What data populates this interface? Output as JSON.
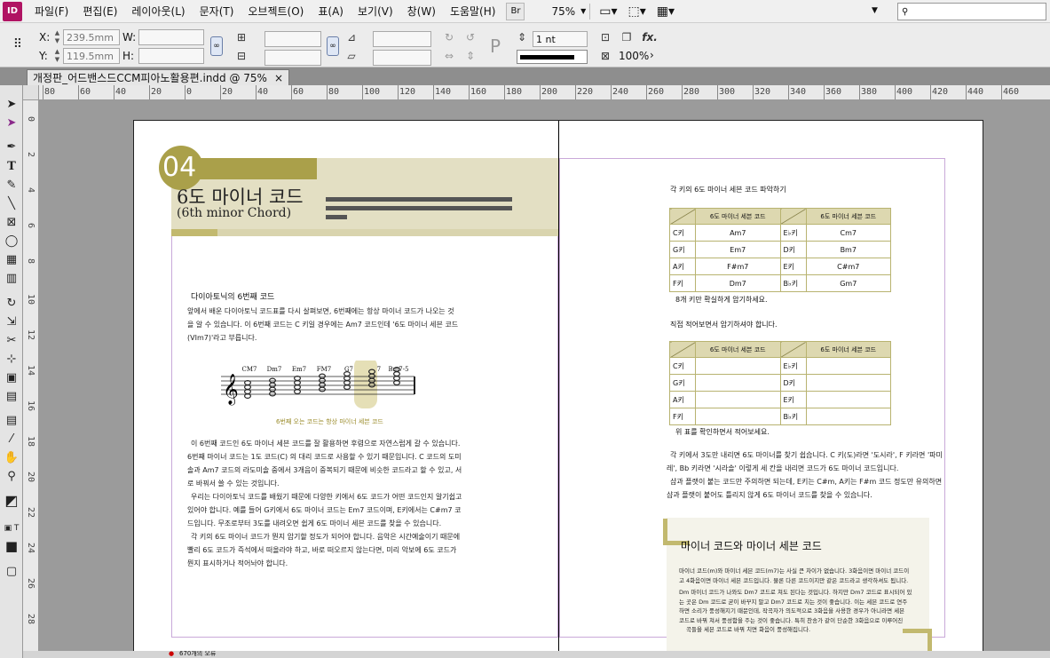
{
  "app": {
    "logo": "ID"
  },
  "menu": [
    "파일(F)",
    "편집(E)",
    "레이아웃(L)",
    "문자(T)",
    "오브젝트(O)",
    "표(A)",
    "보기(V)",
    "창(W)",
    "도움말(H)"
  ],
  "toolbar": {
    "bridge": "Br",
    "zoom": "75%",
    "zoom_caret": "▼"
  },
  "control": {
    "x_label": "X:",
    "x_value": "239.5mm",
    "y_label": "Y:",
    "y_value": "119.5mm",
    "w_label": "W:",
    "h_label": "H:",
    "stroke_weight": "1 nt",
    "opacity": "100%",
    "fx": "fx."
  },
  "document_tab": {
    "title": "개정판_어드밴스드CCM피아노활용편.indd @ 75%",
    "close": "×"
  },
  "ruler": {
    "h_ticks": [
      "80",
      "60",
      "40",
      "20",
      "0",
      "20",
      "40",
      "60",
      "80",
      "100",
      "120",
      "140",
      "160",
      "180",
      "200",
      "220",
      "240",
      "260",
      "280",
      "300",
      "320",
      "340",
      "360",
      "380",
      "400",
      "420",
      "440",
      "460"
    ],
    "v_ticks": [
      "0",
      "2",
      "4",
      "6",
      "8",
      "10",
      "12",
      "14",
      "16",
      "18",
      "20",
      "22",
      "24",
      "26",
      "28"
    ]
  },
  "left_page": {
    "chapter_number": "04",
    "title_ko": "6도 마이너 코드",
    "title_en": "(6th minor  Chord)",
    "section_head": "다이아토닉의 6번째 코드",
    "paragraph1": [
      "앞에서 배운 다이아토닉 코드표를 다시 살펴보면, 6번째에는 항상 마이너 코드가 나오는 것",
      "을 알 수 있습니다. 이 6번째 코드는 C 키일 경우에는 Am7 코드인데 '6도 마이너 세븐 코드",
      "(VIm7)'라고 부릅니다."
    ],
    "chord_names": [
      "CM7",
      "Dm7",
      "Em7",
      "FM7",
      "G7",
      "Am7",
      "Bm7-5"
    ],
    "staff_caption": "6번째 오는 코드는 항상 마이너 세븐 코드",
    "paragraph2": [
      "이 6번째 코드인 6도 마이너 세븐 코드를 잘 활용하면 후렴으로 자연스럽게 갈 수 있습니다.",
      "6번째 마이너 코드는 1도 코드(C) 의 대리 코드로 사용할 수 있기 때문입니다. C 코드의 도미",
      "솔과 Am7 코드의 라도미솔 중에서 3개음이 중복되기 때문에 비슷한 코드라고 할 수 있고, 서",
      "로 바꿔서 쓸 수 있는 것입니다.",
      "우리는 다이아토닉 코드를 배웠기 때문에 다양한 키에서 6도 코드가 어떤 코드인지 알기쉽고",
      "있어야 합니다. 예를 들어 G키에서 6도 마이너 코드는 Em7 코드이며, E키에서는 C#m7 코",
      "드입니다. 무조로부터 3도를 내려오면 쉽게 6도 마이너 세븐 코드를 찾을 수 있습니다.",
      "각 키의 6도 마이너 코드가 뭔지 암기할 정도가 되어야 합니다. 음악은 시간예술이기 때문에",
      "빨리 6도 코드가 즉석에서 떠올라야 하고, 바로 떠오르지 않는다면, 미리 악보에 6도 코드가",
      "뭔지 표시하거나 적어놔야 합니다."
    ]
  },
  "right_page": {
    "table1_title": "각 키의 6도 마이너 세븐 코드 파악하기",
    "table_header": "6도 마이너 세븐 코드",
    "table1_rows": [
      [
        "C키",
        "Am7",
        "E♭키",
        "Cm7"
      ],
      [
        "G키",
        "Em7",
        "D키",
        "Bm7"
      ],
      [
        "A키",
        "F#m7",
        "E키",
        "C#m7"
      ],
      [
        "F키",
        "Dm7",
        "B♭키",
        "Gm7"
      ]
    ],
    "table1_note": "8개 키만 확실하게 암기하세요.",
    "table2_title": "직접 적어보면서 암기하셔야 합니다.",
    "table2_rows": [
      [
        "C키",
        "",
        "E♭키",
        ""
      ],
      [
        "G키",
        "",
        "D키",
        ""
      ],
      [
        "A키",
        "",
        "E키",
        ""
      ],
      [
        "F키",
        "",
        "B♭키",
        ""
      ]
    ],
    "table2_note": "위 표를 확인하면서 적어보세요.",
    "paragraph": [
      "각 키에서 3도만 내리면 6도 마이너를 찾기 쉽습니다. C 키(도)라면 '도시라', F 키라면 '파미",
      "레', Bb 키라면 '시라솔' 이렇게 세 칸을 내리면 코드가 6도 마이너 코드입니다.",
      "샵과 플랫이 붙는 코드만 주의하면 되는데, E키는 C#m, A키는 F#m 코드 정도만 유의하면",
      "샵과 플랫이 붙어도 틀리지 않게 6도 마이너 코드를 찾을 수 있습니다."
    ],
    "tip_title": "마이너 코드와 마이너 세븐 코드",
    "tip_body": [
      "마이너 코드(m)와 마이너 세븐 코드(m7)는 사실 큰 차이가 없습니다. 3화음이면 마이너 코드이",
      "고 4화음이면 마이너 세븐 코드입니다. 물론 다른 코드이지만 같은 코드라고 생각하셔도 됩니다.",
      "Dm 마이너 코드가 나와도 Dm7 코드로 쳐도 된다는 것입니다. 하지만 Dm7 코드로 표시되어 있",
      "는 곳은 Dm 코드로 굳이 바꾸지 말고 Dm7 코드로 치는 것이 좋습니다. 이는 세븐 코드로 연주",
      "하면 소리가 풍성해지기 때문인데, 작곡자가 의도적으로 3화음을 사용한 경우가 아니라면 세븐",
      "코드로 바꿔 쳐서 풍성함을 주는 것이 좋습니다. 특히 찬송가 같이 단순한 3화음으로 이루어진",
      "곡들을 세븐 코드로 바꿔 치면 화음이 풍성해집니다."
    ]
  },
  "status": {
    "text": "670개의 오류"
  }
}
